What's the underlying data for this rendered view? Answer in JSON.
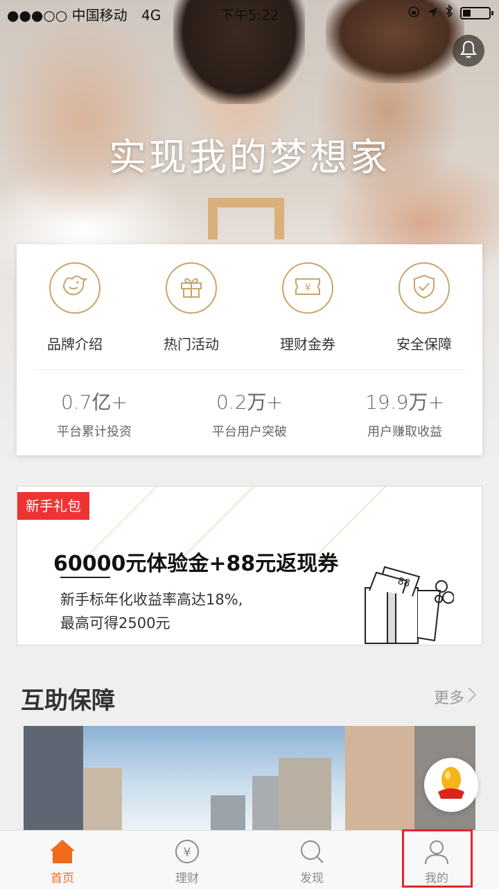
{
  "status_bar": {
    "signal_carrier": "●●●○○ 中国移动",
    "network": "4G",
    "time": "下午5:22",
    "battery_level": 0.3
  },
  "hero": {
    "title": "实现我的梦想家",
    "bell_icon": "bell-icon"
  },
  "quick_menu": [
    {
      "label": "品牌介绍",
      "icon": "bird-icon"
    },
    {
      "label": "热门活动",
      "icon": "gift-icon"
    },
    {
      "label": "理财金券",
      "icon": "coupon-icon"
    },
    {
      "label": "安全保障",
      "icon": "shield-check-icon"
    }
  ],
  "stats": [
    {
      "value": "0.7亿+",
      "label": "平台累计投资"
    },
    {
      "value": "0.2万+",
      "label": "平台用户突破"
    },
    {
      "value": "19.9万+",
      "label": "用户赚取收益"
    }
  ],
  "promo": {
    "tag": "新手礼包",
    "title": "60000元体验金+88元返现券",
    "desc_line1": "新手标年化收益率高达18%,",
    "desc_line2": "最高可得2500元",
    "coupon_number": "88"
  },
  "section": {
    "title": "互助保障",
    "more": "更多"
  },
  "tabs": [
    {
      "label": "首页",
      "icon": "home-icon",
      "active": true
    },
    {
      "label": "理财",
      "icon": "yen-circle-icon",
      "active": false
    },
    {
      "label": "发现",
      "icon": "search-icon",
      "active": false
    },
    {
      "label": "我的",
      "icon": "user-icon",
      "active": false
    }
  ],
  "colors": {
    "accent": "#f26b1d",
    "gold": "#c9a46a",
    "tag_red": "#ee3433",
    "highlight_red": "#e0262c"
  }
}
